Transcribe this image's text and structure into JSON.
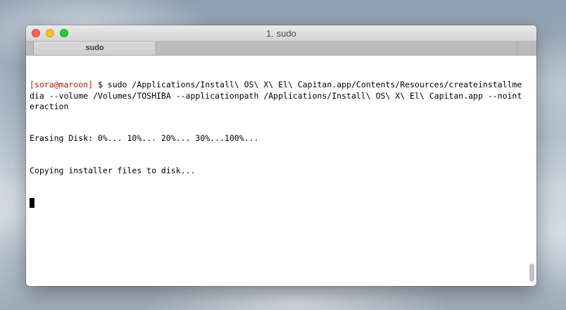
{
  "window": {
    "title": "1. sudo"
  },
  "tabs": [
    {
      "label": "sudo",
      "active": true
    }
  ],
  "terminal": {
    "prompt": "[sora@maroon]",
    "command": " $ sudo /Applications/Install\\ OS\\ X\\ El\\ Capitan.app/Contents/Resources/createinstallmedia --volume /Volumes/TOSHIBA --applicationpath /Applications/Install\\ OS\\ X\\ El\\ Capitan.app --nointeraction",
    "output": [
      "Erasing Disk: 0%... 10%... 20%... 30%...100%...",
      "Copying installer files to disk..."
    ]
  },
  "colors": {
    "prompt": "#b8160c",
    "close": "#fc5f57",
    "minimize": "#fdbc2e",
    "maximize": "#28c840"
  }
}
